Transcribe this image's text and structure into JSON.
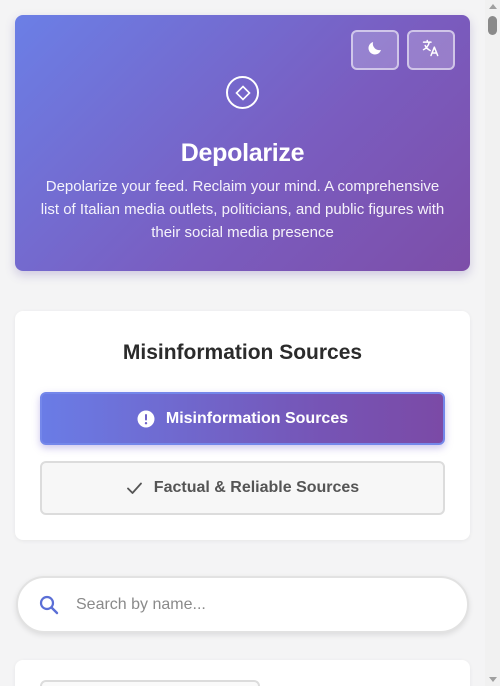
{
  "hero": {
    "title": "Depolarize",
    "description": "Depolarize your feed. Reclaim your mind. A comprehensive list of Italian media outlets, politicians, and public figures with their social media presence",
    "theme_icon": "moon-icon",
    "language_icon": "translate-icon",
    "logo_icon": "diamond-icon"
  },
  "sources": {
    "title": "Misinformation Sources",
    "tabs": [
      {
        "label": "Misinformation Sources",
        "icon": "alert-icon",
        "active": true
      },
      {
        "label": "Factual & Reliable Sources",
        "icon": "check-icon",
        "active": false
      }
    ]
  },
  "search": {
    "placeholder": "Search by name...",
    "value": ""
  },
  "colors": {
    "accent_start": "#6b7fe6",
    "accent_end": "#7d4ea8",
    "search_icon": "#5b6fd6"
  }
}
